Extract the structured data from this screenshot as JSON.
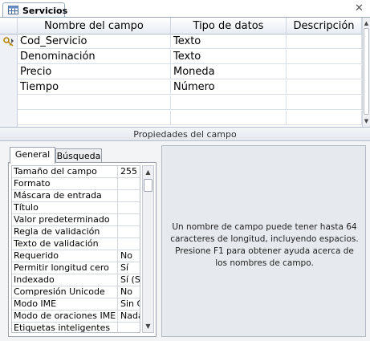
{
  "window": {
    "tab_title": "Servicios",
    "close_glyph": "✕"
  },
  "grid": {
    "columns": [
      "Nombre del campo",
      "Tipo de datos",
      "Descripción"
    ],
    "rows": [
      {
        "name": "Cod_Servicio",
        "type": "Texto",
        "description": "",
        "primary_key": true
      },
      {
        "name": "Denominación",
        "type": "Texto",
        "description": ""
      },
      {
        "name": "Precio",
        "type": "Moneda",
        "description": ""
      },
      {
        "name": "Tiempo",
        "type": "Número",
        "description": ""
      }
    ]
  },
  "properties": {
    "title": "Propiedades del campo",
    "tabs": [
      "General",
      "Búsqueda"
    ],
    "active_tab": "General",
    "rows": [
      {
        "label": "Tamaño del campo",
        "value": "255"
      },
      {
        "label": "Formato",
        "value": ""
      },
      {
        "label": "Máscara de entrada",
        "value": ""
      },
      {
        "label": "Título",
        "value": ""
      },
      {
        "label": "Valor predeterminado",
        "value": ""
      },
      {
        "label": "Regla de validación",
        "value": ""
      },
      {
        "label": "Texto de validación",
        "value": ""
      },
      {
        "label": "Requerido",
        "value": "No"
      },
      {
        "label": "Permitir longitud cero",
        "value": "Sí"
      },
      {
        "label": "Indexado",
        "value": "Sí (Si"
      },
      {
        "label": "Compresión Unicode",
        "value": "No"
      },
      {
        "label": "Modo IME",
        "value": "Sin C"
      },
      {
        "label": "Modo de oraciones IME",
        "value": "Nada"
      },
      {
        "label": "Etiquetas inteligentes",
        "value": ""
      }
    ],
    "help_text": "Un nombre de campo puede tener hasta 64 caracteres de longitud, incluyendo espacios. Presione F1 para obtener ayuda acerca de los nombres de campo."
  },
  "icons": {
    "table": "table-icon",
    "key": "primary-key-icon",
    "close": "close-icon"
  },
  "colors": {
    "header_border": "#9aa7ba",
    "help_bg": "#e6e9ee",
    "panel_bg": "#f3f4f6",
    "key_color": "#d4a20a"
  }
}
